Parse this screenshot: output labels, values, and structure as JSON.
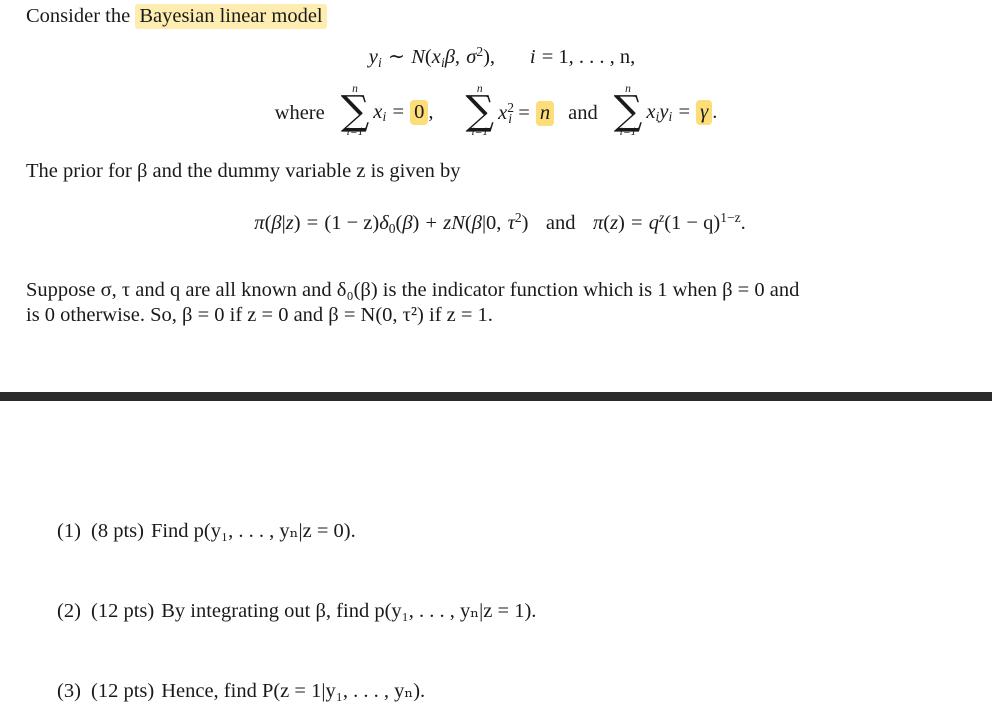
{
  "document": {
    "type": "statistics-exam-question",
    "intro": {
      "prefix": "Consider the",
      "highlighted_term": "Bayesian linear model"
    },
    "model_equation": {
      "response": "y",
      "response_sub": "i",
      "distribution": "N",
      "mean": "x",
      "mean_sub": "i",
      "coefficient": "β",
      "variance": "σ",
      "variance_exp": "2",
      "index_var": "i",
      "index_eq": "= 1, . . . , n,",
      "tilde": "∼",
      "comma": ",",
      "open_paren": "(",
      "close_paren": ")"
    },
    "constraints": {
      "where_label": "where",
      "and_label": "and",
      "sum_symbol": "∑",
      "limit_top": "n",
      "limit_bottom": "i=1",
      "items": [
        {
          "term": "x",
          "term_sub": "i",
          "term_exp": "",
          "equals": "=",
          "value": "0",
          "value_highlighted": true,
          "trailing": ","
        },
        {
          "term": "x",
          "term_sub": "i",
          "term_exp": "2",
          "equals": "=",
          "value": "n",
          "value_highlighted": true,
          "trailing": ""
        },
        {
          "term": "x",
          "term_sub": "i",
          "term2": "y",
          "term2_sub": "i",
          "equals": "=",
          "value": "γ",
          "value_highlighted": true,
          "trailing": "."
        }
      ]
    },
    "prior_intro": "The prior for β and the dummy variable z is given by",
    "prior_equation": {
      "pi": "π",
      "beta": "β",
      "bar": "|",
      "z": "z",
      "equals": "=",
      "one_minus_z": "(1 − z)",
      "delta": "δ",
      "delta_sub": "0",
      "plus": "+",
      "normal": "N",
      "zero": "0",
      "tau": "τ",
      "tau_exp": "2",
      "and_label": "and",
      "q": "q",
      "q_exp": "z",
      "one_minus_q": "(1 − q)",
      "q_outer_exp": "1−z",
      "period": "."
    },
    "suppose_paragraph": {
      "line1": "Suppose σ, τ and q are all known and δ₀(β) is the indicator function which is 1 when β = 0 and",
      "line2": "is 0 otherwise. So, β = 0 if z = 0 and β = N(0, τ²) if z = 1."
    },
    "questions": [
      {
        "number": "(1)",
        "points": "(8 pts)",
        "text": "Find p(y₁, . . . , yₙ|z = 0).",
        "verb": "Find",
        "target": "p(y₁, . . . , yₙ|z = 0)."
      },
      {
        "number": "(2)",
        "points": "(12 pts)",
        "text": "By integrating out β, find p(y₁, . . . , yₙ|z = 1).",
        "verb": "By integrating out β, find",
        "target": "p(y₁, . . . , yₙ|z = 1)."
      },
      {
        "number": "(3)",
        "points": "(12 pts)",
        "text": "Hence, find P(z = 1|y₁, . . . , yₙ).",
        "verb": "Hence, find",
        "target": "P(z = 1|y₁, . . . , yₙ)."
      }
    ],
    "colors": {
      "title_highlight": "#fdedb0",
      "value_highlight": "#fcdd78",
      "divider": "#2b2b2b",
      "text": "#1a1a1a",
      "background": "#ffffff"
    }
  }
}
